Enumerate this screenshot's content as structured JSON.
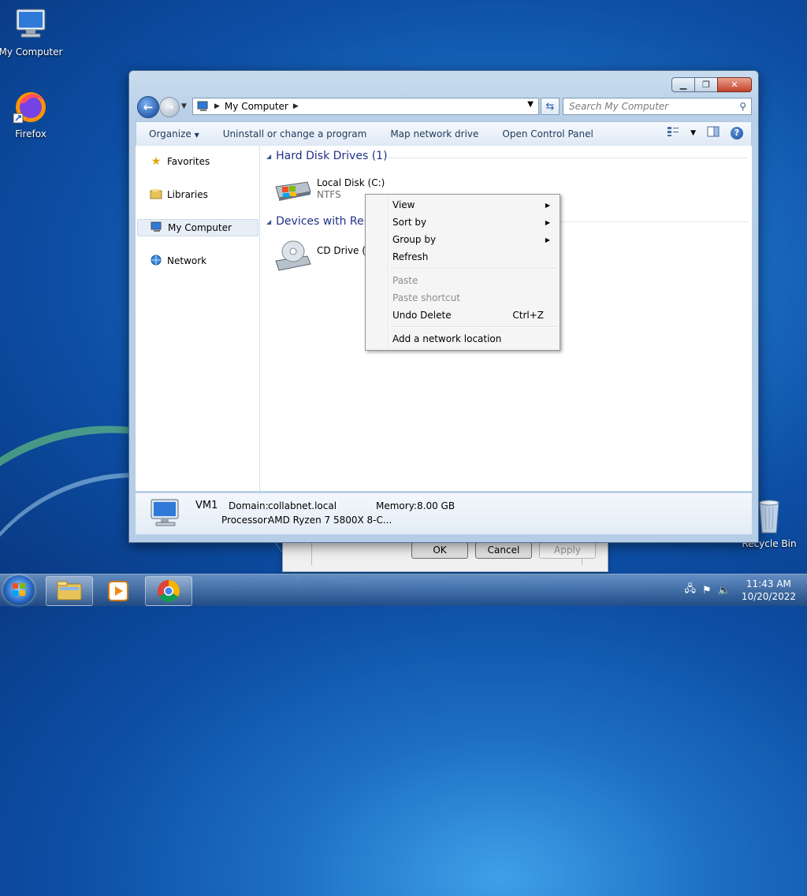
{
  "desktop": {
    "icons": [
      {
        "label": "My Computer"
      },
      {
        "label": "Firefox"
      },
      {
        "label": "Recycle Bin"
      }
    ]
  },
  "window": {
    "address": {
      "crumb": "My Computer"
    },
    "search": {
      "placeholder": "Search My Computer"
    },
    "toolbar": {
      "organize": "Organize",
      "uninstall": "Uninstall or change a program",
      "map_drive": "Map network drive",
      "control_panel": "Open Control Panel"
    },
    "nav": [
      {
        "label": "Favorites"
      },
      {
        "label": "Libraries"
      },
      {
        "label": "My Computer"
      },
      {
        "label": "Network"
      }
    ],
    "groups": {
      "hdd": {
        "title": "Hard Disk Drives (1)"
      },
      "removable": {
        "title": "Devices with Ren"
      }
    },
    "drives": [
      {
        "name": "Local Disk (C:)",
        "fs": "NTFS"
      },
      {
        "name": "CD Drive (D"
      }
    ],
    "details": {
      "name": "VM1",
      "domain_key": "Domain:",
      "domain_val": "collabnet.local",
      "memory_key": "Memory:",
      "memory_val": "8.00 GB",
      "processor_key": "Processor:",
      "processor_val": "AMD Ryzen 7 5800X 8-C..."
    }
  },
  "context_menu": {
    "items": [
      {
        "label": "View",
        "submenu": true,
        "enabled": true
      },
      {
        "label": "Sort by",
        "submenu": true,
        "enabled": true
      },
      {
        "label": "Group by",
        "submenu": true,
        "enabled": true
      },
      {
        "label": "Refresh",
        "enabled": true
      },
      {
        "label": "Paste",
        "enabled": false
      },
      {
        "label": "Paste shortcut",
        "enabled": false
      },
      {
        "label": "Undo Delete",
        "shortcut": "Ctrl+Z",
        "enabled": true
      },
      {
        "label": "Add a network location",
        "enabled": true
      }
    ]
  },
  "bg_dialog": {
    "ok": "OK",
    "cancel": "Cancel",
    "apply": "Apply"
  },
  "taskbar": {
    "time": "11:43 AM",
    "date": "10/20/2022"
  }
}
